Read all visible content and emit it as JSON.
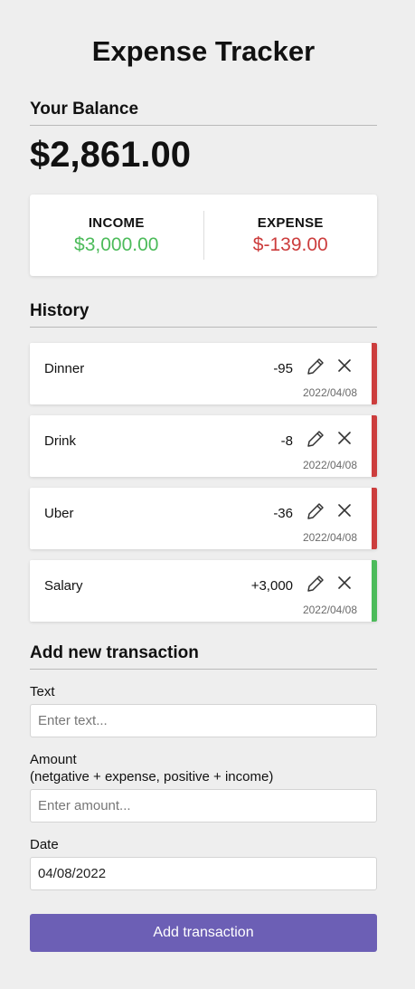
{
  "app": {
    "title": "Expense Tracker"
  },
  "balance": {
    "heading": "Your Balance",
    "amount": "$2,861.00"
  },
  "summary": {
    "income_label": "INCOME",
    "income_value": "$3,000.00",
    "expense_label": "EXPENSE",
    "expense_value": "$-139.00"
  },
  "history": {
    "heading": "History",
    "items": [
      {
        "name": "Dinner",
        "amount": "-95",
        "date": "2022/04/08",
        "type": "expense"
      },
      {
        "name": "Drink",
        "amount": "-8",
        "date": "2022/04/08",
        "type": "expense"
      },
      {
        "name": "Uber",
        "amount": "-36",
        "date": "2022/04/08",
        "type": "expense"
      },
      {
        "name": "Salary",
        "amount": "+3,000",
        "date": "2022/04/08",
        "type": "income"
      }
    ],
    "edit_icon": "pencil-icon",
    "delete_icon": "close-icon"
  },
  "form": {
    "heading": "Add new transaction",
    "text_label": "Text",
    "text_placeholder": "Enter text...",
    "text_value": "",
    "amount_label_line1": "Amount",
    "amount_label_line2": "(netgative + expense, positive + income)",
    "amount_placeholder": "Enter amount...",
    "amount_value": "",
    "date_label": "Date",
    "date_value": "04/08/2022",
    "submit_label": "Add transaction"
  },
  "colors": {
    "background": "#eeeeee",
    "income": "#4cbb5a",
    "expense": "#cc3d3d",
    "accent": "#6c5fb5"
  }
}
